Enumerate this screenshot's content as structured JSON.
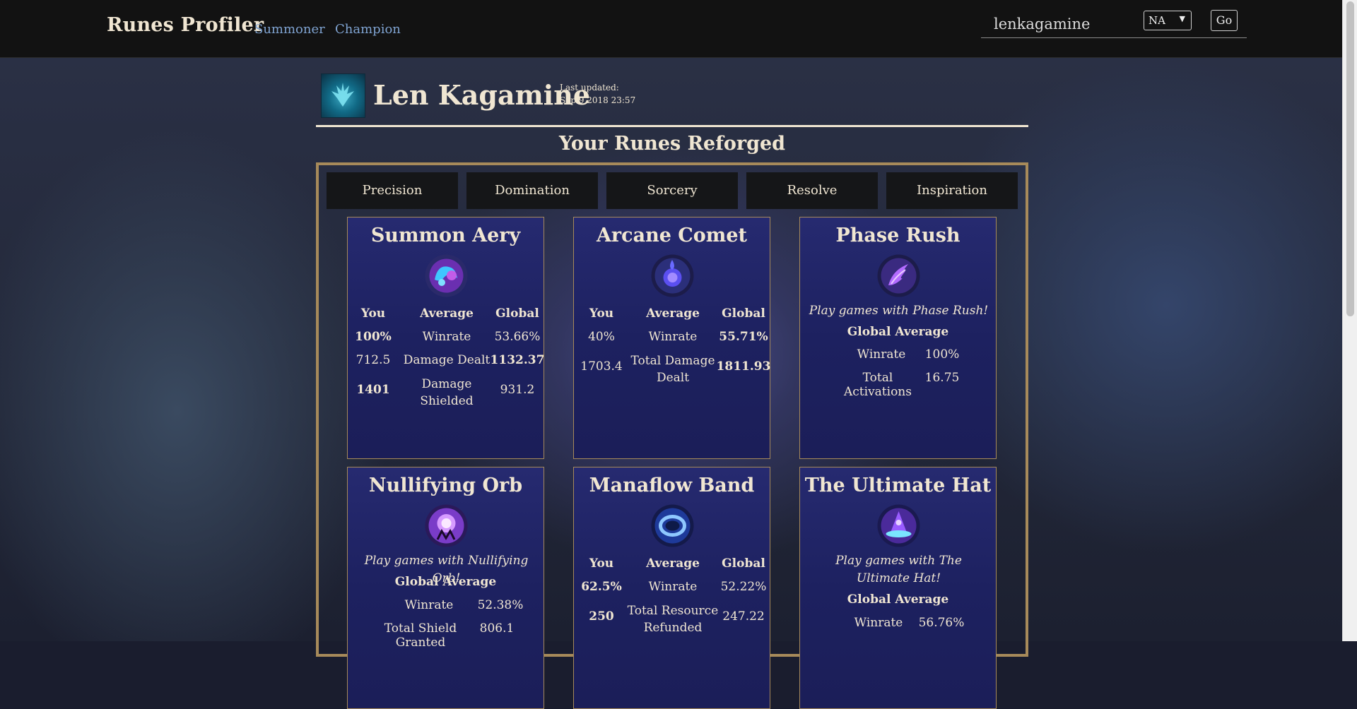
{
  "nav": {
    "brand": "Runes Profiler",
    "links": [
      "Summoner",
      "Champion"
    ],
    "search_value": "lenkagamine",
    "region": "NA",
    "go_label": "Go"
  },
  "summoner": {
    "name": "Len Kagamine",
    "updated_label": "Last updated:",
    "updated_value": "Sep 9 2018 23:57"
  },
  "section_title": "Your Runes Reforged",
  "tabs": [
    "Precision",
    "Domination",
    "Sorcery",
    "Resolve",
    "Inspiration"
  ],
  "headers": {
    "you": "You",
    "average": "Average",
    "global": "Global"
  },
  "cards": [
    {
      "title": "Summon Aery",
      "icon": "summon-aery-icon",
      "rows": [
        {
          "you": "100%",
          "label": "Winrate",
          "global": "53.66%"
        },
        {
          "you": "712.5",
          "label": "Damage Dealt",
          "global": "1132.37"
        },
        {
          "you": "1401",
          "label": "Damage Shielded",
          "global": "931.2"
        }
      ]
    },
    {
      "title": "Arcane Comet",
      "icon": "arcane-comet-icon",
      "rows": [
        {
          "you": "40%",
          "label": "Winrate",
          "global": "55.71%"
        },
        {
          "you": "1703.4",
          "label": "Total Damage Dealt",
          "global": "1811.93"
        }
      ]
    },
    {
      "title": "Phase Rush",
      "icon": "phase-rush-icon",
      "prompt": "Play games with Phase Rush!",
      "global_avg_label": "Global Average",
      "avg_rows": [
        {
          "label": "Winrate",
          "value": "100%"
        },
        {
          "label": "Total Activations",
          "value": "16.75"
        }
      ]
    },
    {
      "title": "Nullifying Orb",
      "icon": "nullifying-orb-icon",
      "prompt": "Play games with Nullifying Orb!",
      "global_avg_label": "Global Average",
      "avg_rows": [
        {
          "label": "Winrate",
          "value": "52.38%"
        },
        {
          "label": "Total Shield Granted",
          "value": "806.1"
        }
      ]
    },
    {
      "title": "Manaflow Band",
      "icon": "manaflow-band-icon",
      "rows": [
        {
          "you": "62.5%",
          "label": "Winrate",
          "global": "52.22%"
        },
        {
          "you": "250",
          "label": "Total Resource Refunded",
          "global": "247.22"
        }
      ]
    },
    {
      "title": "The Ultimate Hat",
      "icon": "ultimate-hat-icon",
      "prompt": "Play games with The Ultimate Hat!",
      "global_avg_label": "Global Average",
      "avg_rows": [
        {
          "label": "Winrate",
          "value": "56.76%"
        }
      ]
    }
  ]
}
